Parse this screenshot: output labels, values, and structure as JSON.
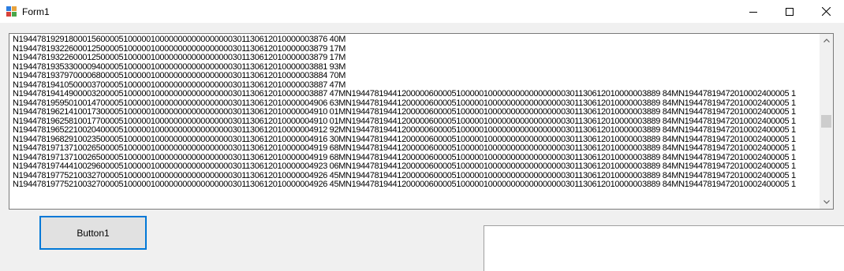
{
  "window": {
    "title": "Form1",
    "app_icon": "winforms-app-icon",
    "minimize_icon": "minimize-icon",
    "maximize_icon": "maximize-icon",
    "close_icon": "close-icon"
  },
  "textbox": {
    "lines": [
      "N19447819291800015600005100000100000000000000000301130612010000003876 40M",
      "N19447819322600012500005100000100000000000000000301130612010000003879 17M",
      "N19447819322600012500005100000100000000000000000301130612010000003879 17M",
      "N19447819353300009400005100000100000000000000000301130612010000003881 93M",
      "N19447819379700006800005100000100000000000000000301130612010000003884 70M",
      "N19447819410500003700005100000100000000000000000301130612010000003887 47M",
      "N19447819414900003200005100000100000000000000000301130612010000003887 47MN19447819441200000600005100000100000000000000000301130612010000003889 84MN19447819472010002400005 1",
      "N19447819595010014700005100000100000000000000000301130612010000004906 63MN19447819441200000600005100000100000000000000000301130612010000003889 84MN19447819472010002400005 1",
      "N19447819621410017300005100000100000000000000000301130612010000004910 01MN19447819441200000600005100000100000000000000000301130612010000003889 84MN19447819472010002400005 1",
      "N19447819625810017700005100000100000000000000000301130612010000004910 01MN19447819441200000600005100000100000000000000000301130612010000003889 84MN19447819472010002400005 1",
      "N19447819652210020400005100000100000000000000000301130612010000004912 92MN19447819441200000600005100000100000000000000000301130612010000003889 84MN19447819472010002400005 1",
      "N19447819682910023500005100000100000000000000000301130612010000004916 30MN19447819441200000600005100000100000000000000000301130612010000003889 84MN19447819472010002400005 1",
      "N19447819713710026500005100000100000000000000000301130612010000004919 68MN19447819441200000600005100000100000000000000000301130612010000003889 84MN19447819472010002400005 1",
      "N19447819713710026500005100000100000000000000000301130612010000004919 68MN19447819441200000600005100000100000000000000000301130612010000003889 84MN19447819472010002400005 1",
      "N19447819744410029600005100000100000000000000000301130612010000004923 06MN19447819441200000600005100000100000000000000000301130612010000003889 84MN19447819472010002400005 1",
      "N19447819775210032700005100000100000000000000000301130612010000004926 45MN19447819441200000600005100000100000000000000000301130612010000003889 84MN19447819472010002400005 1",
      "N19447819775210032700005100000100000000000000000301130612010000004926 45MN19447819441200000600005100000100000000000000000301130612010000003889 84MN19447819472010002400005 1"
    ],
    "scroll_up_icon": "chevron-up-icon",
    "scroll_down_icon": "chevron-down-icon",
    "scroll_position": 0.5
  },
  "button1": {
    "label": "Button1"
  }
}
